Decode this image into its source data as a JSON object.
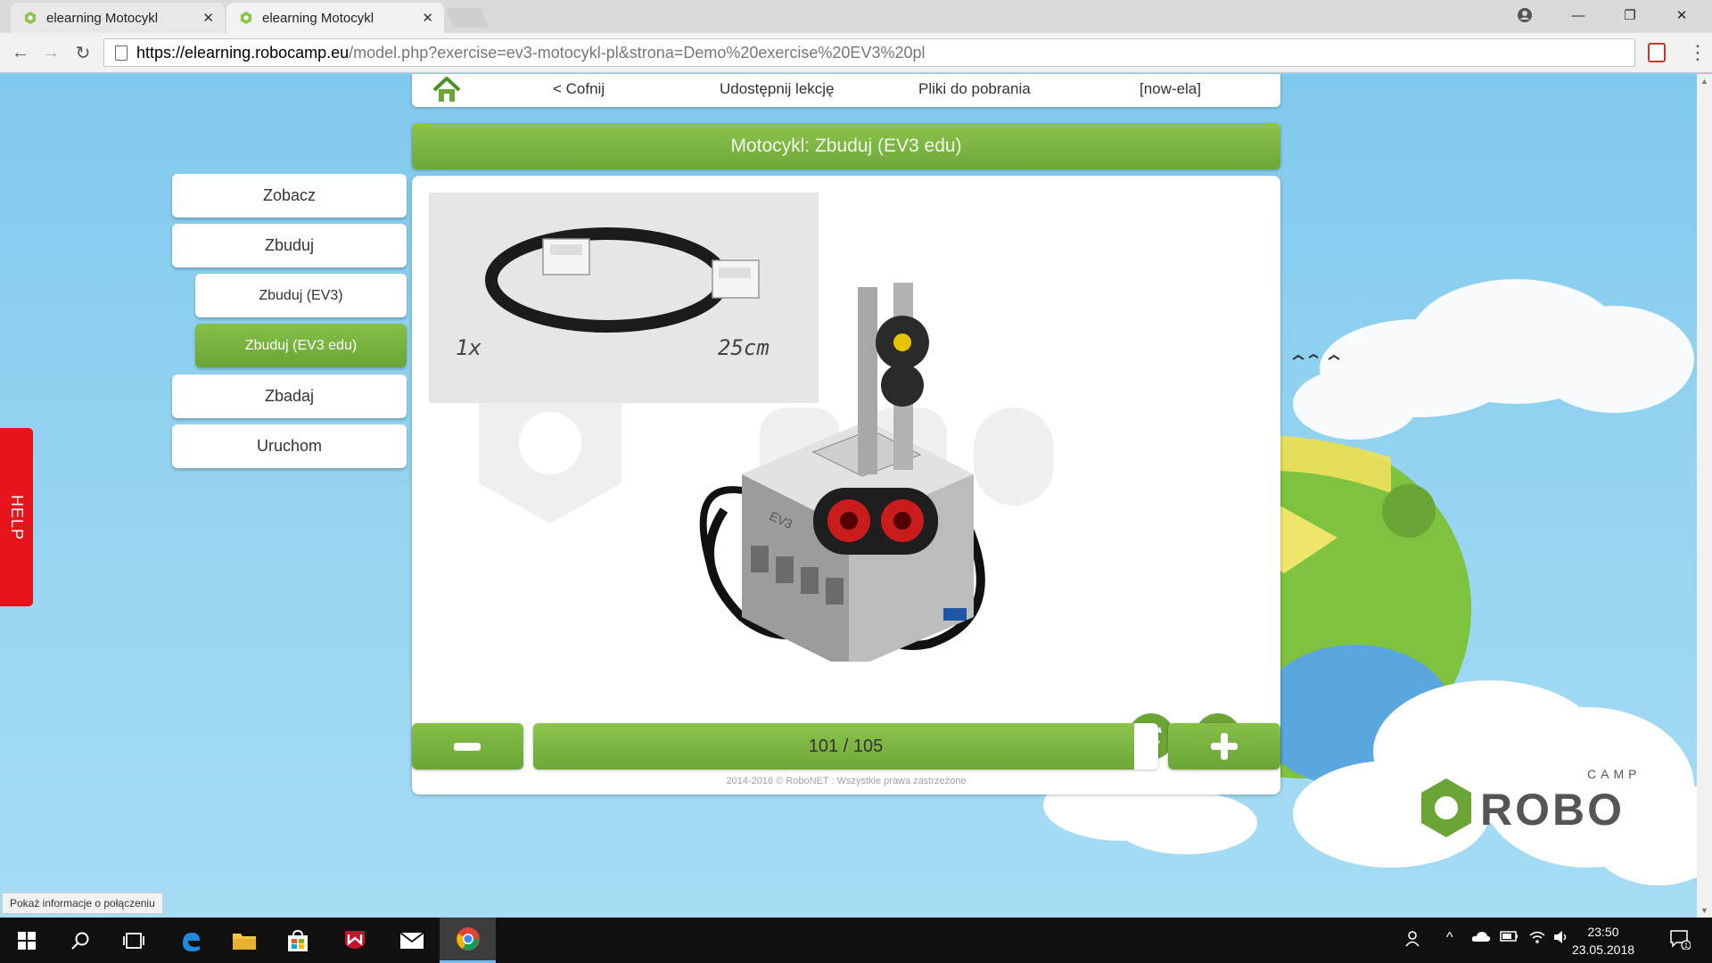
{
  "browser": {
    "tabs": [
      {
        "title": "elearning Motocykl",
        "active": false
      },
      {
        "title": "elearning Motocykl",
        "active": true
      }
    ],
    "url": {
      "scheme_host": "https://elearning.robocamp.eu",
      "path": "/model.php?exercise=ev3-motocykl-pl&strona=Demo%20exercise%20EV3%20pl"
    },
    "status_tooltip": "Pokaż informacje o połączeniu"
  },
  "top_menu": {
    "back_label": "< Cofnij",
    "share_label": "Udostępnij lekcję",
    "downloads_label": "Pliki do pobrania",
    "user_label": "[now-ela]"
  },
  "page_title": "Motocykl: Zbuduj (EV3 edu)",
  "sidebar": {
    "items": [
      {
        "label": "Zobacz"
      },
      {
        "label": "Zbuduj"
      },
      {
        "label": "Zbuduj (EV3)"
      },
      {
        "label": "Zbuduj (EV3 edu)"
      },
      {
        "label": "Zbadaj"
      },
      {
        "label": "Uruchom"
      }
    ]
  },
  "help_label": "HELP",
  "part_callout": {
    "quantity": "1x",
    "length": "25cm"
  },
  "model_label": "EV3",
  "pagination": {
    "current": 101,
    "total": 105,
    "text": "101 / 105",
    "progress": 0.962
  },
  "footer": {
    "copyright": "2014-2016 © RoboNET : Wszystkie prawa zastrzeżone"
  },
  "logo": {
    "small": "CAMP",
    "main": "ROBO"
  },
  "taskbar": {
    "time": "23:50",
    "date": "23.05.2018",
    "notification_count": "1"
  },
  "colors": {
    "accent_green": "#6ea73a",
    "help_red": "#e8141b",
    "sky": "#8fd0ee"
  }
}
